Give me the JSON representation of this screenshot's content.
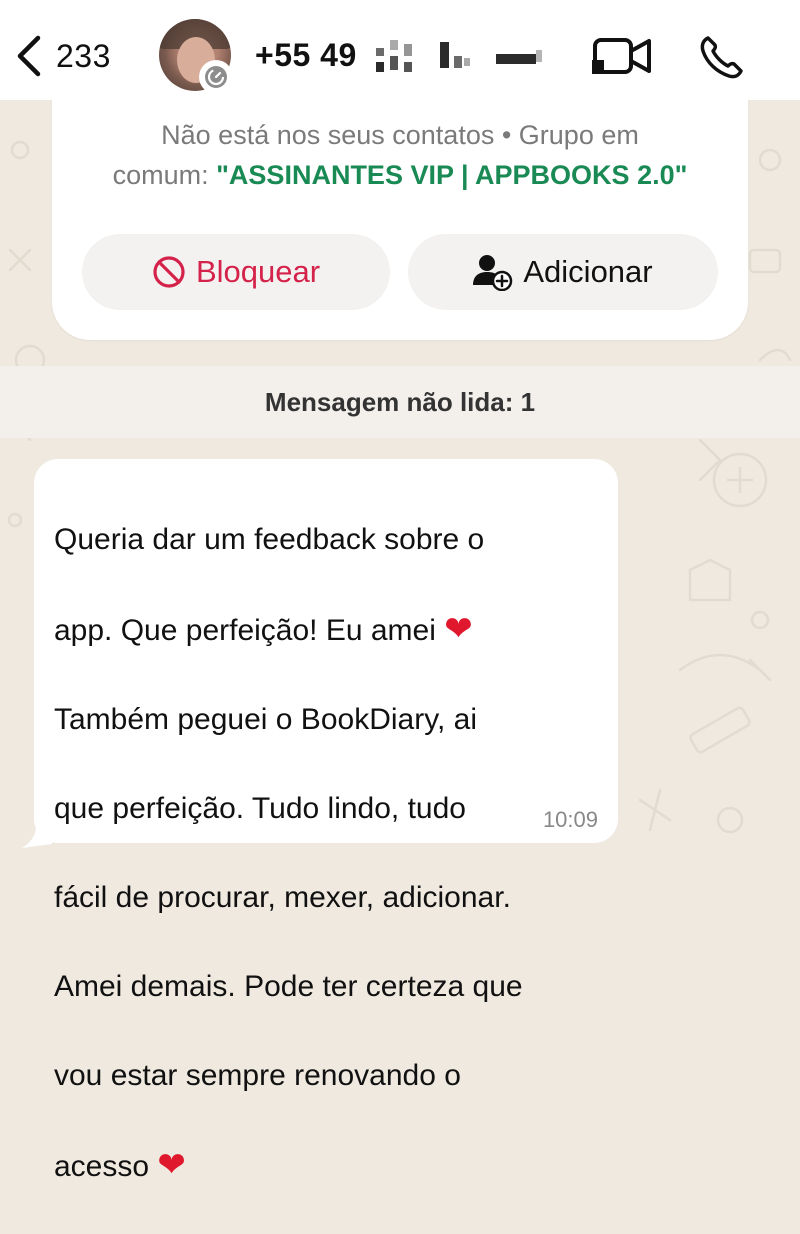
{
  "header": {
    "back_count": "233",
    "phone_prefix": "+55 49",
    "icons": {
      "back": "chevron-left-icon",
      "video": "video-call-icon",
      "call": "phone-call-icon",
      "status": "timer-icon"
    }
  },
  "contact_card": {
    "info_line1": "Não está nos seus contatos • Grupo em",
    "info_line2_prefix": "comum: ",
    "group_name": "\"ASSINANTES VIP | APPBOOKS 2.0\"",
    "block_label": "Bloquear",
    "add_label": "Adicionar"
  },
  "unread_divider": "Mensagem não lida: 1",
  "message": {
    "line1": "Queria dar um feedback sobre o",
    "line2": "app. Que perfeição! Eu amei ",
    "heart": "❤",
    "line3": "Também peguei o BookDiary, ai",
    "line4": "que perfeição. Tudo lindo, tudo",
    "line5": "fácil de procurar, mexer, adicionar.",
    "line6": "Amei demais. Pode ter certeza que",
    "line7": "vou estar sempre renovando o",
    "line8": "acesso ",
    "time": "10:09"
  },
  "colors": {
    "accent_green": "#1a8a55",
    "danger_red": "#d4224a",
    "wallpaper": "#efe9e0"
  }
}
